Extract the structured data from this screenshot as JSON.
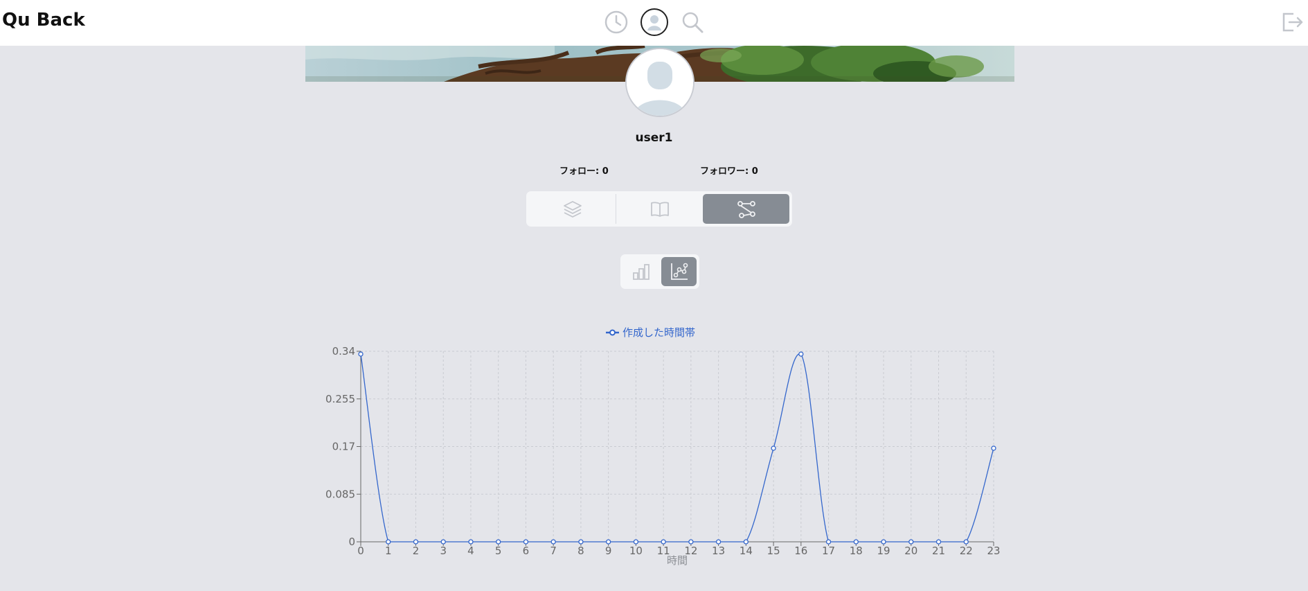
{
  "app": {
    "title": "Qu Back"
  },
  "header": {
    "icons": [
      "clock-icon",
      "user-icon",
      "search-icon",
      "logout-icon"
    ]
  },
  "profile": {
    "username": "user1",
    "follow_label": "フォロー: 0",
    "follower_label": "フォロワー: 0"
  },
  "tabs": [
    "layers-icon",
    "book-icon",
    "graph-icon"
  ],
  "subtabs": [
    "bar-chart-icon",
    "line-chart-icon"
  ],
  "colors": {
    "accent": "#3366cc",
    "background": "#e4e5ea",
    "active_tab": "#868c94"
  },
  "chart_data": {
    "type": "line",
    "title": "",
    "xlabel": "時間",
    "ylabel": "",
    "legend": "top-center",
    "series": [
      {
        "name": "作成した時間帯",
        "x": [
          0,
          1,
          2,
          3,
          4,
          5,
          6,
          7,
          8,
          9,
          10,
          11,
          12,
          13,
          14,
          15,
          16,
          17,
          18,
          19,
          20,
          21,
          22,
          23
        ],
        "values": [
          0.335,
          0,
          0,
          0,
          0,
          0,
          0,
          0,
          0,
          0,
          0,
          0,
          0,
          0,
          0,
          0.167,
          0.335,
          0,
          0,
          0,
          0,
          0,
          0,
          0.167
        ]
      }
    ],
    "categories": [
      "0",
      "1",
      "2",
      "3",
      "4",
      "5",
      "6",
      "7",
      "8",
      "9",
      "10",
      "11",
      "12",
      "13",
      "14",
      "15",
      "16",
      "17",
      "18",
      "19",
      "20",
      "21",
      "22",
      "23"
    ],
    "yticks": [
      "0",
      "0.085",
      "0.17",
      "0.255",
      "0.34"
    ],
    "ylim": [
      0,
      0.34
    ],
    "grid": true
  }
}
